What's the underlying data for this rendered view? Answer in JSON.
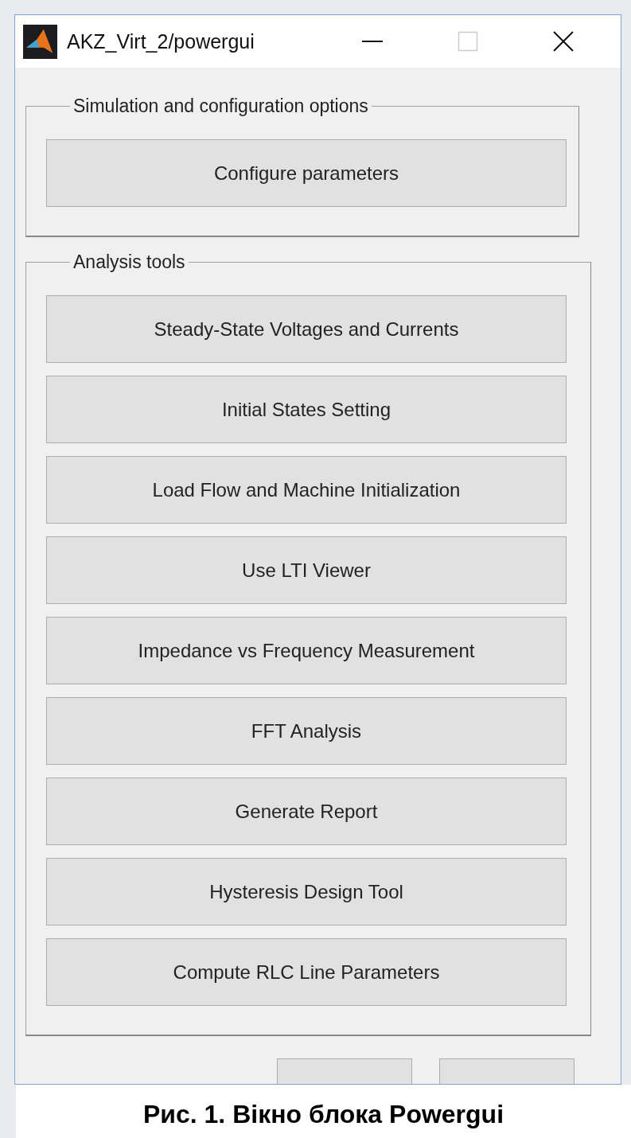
{
  "window": {
    "title": "AKZ_Virt_2/powergui"
  },
  "groups": [
    {
      "title": "Simulation and configuration options",
      "buttons": [
        "Configure parameters"
      ]
    },
    {
      "title": "Analysis tools",
      "buttons": [
        "Steady-State Voltages and Currents",
        "Initial States Setting",
        "Load Flow and Machine Initialization",
        "Use LTI Viewer",
        "Impedance vs Frequency Measurement",
        "FFT Analysis",
        "Generate Report",
        "Hysteresis Design Tool",
        "Compute RLC  Line Parameters"
      ]
    }
  ],
  "caption": "Рис. 1. Вікно блока Powergui"
}
